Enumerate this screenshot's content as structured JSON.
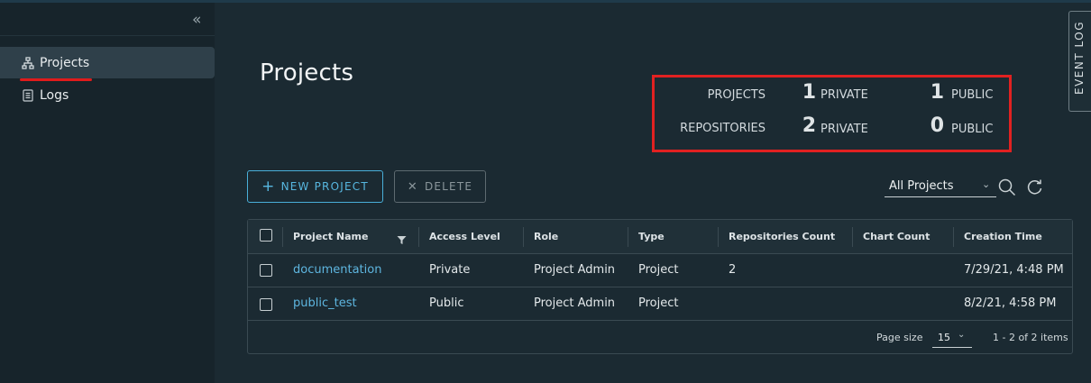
{
  "sidebar": {
    "collapse_glyph": "«",
    "items": [
      {
        "label": "Projects",
        "icon": "projects-tree-icon",
        "active": true
      },
      {
        "label": "Logs",
        "icon": "logs-document-icon",
        "active": false
      }
    ]
  },
  "page": {
    "title": "Projects"
  },
  "summary": {
    "projects_label": "PROJECTS",
    "projects_private": "1",
    "projects_public": "1",
    "repositories_label": "REPOSITORIES",
    "repositories_private": "2",
    "repositories_public": "0",
    "private_label": "PRIVATE",
    "public_label": "PUBLIC",
    "highlight_color": "#e12121"
  },
  "event_log": {
    "label": "EVENT LOG"
  },
  "toolbar": {
    "new_project_label": "NEW PROJECT",
    "delete_label": "DELETE",
    "filter_value": "All Projects",
    "search_icon": "search-icon",
    "refresh_icon": "refresh-icon"
  },
  "table": {
    "columns": [
      "Project Name",
      "Access Level",
      "Role",
      "Type",
      "Repositories Count",
      "Chart Count",
      "Creation Time"
    ],
    "rows": [
      {
        "name": "documentation",
        "access": "Private",
        "role": "Project Admin",
        "type": "Project",
        "repos": "2",
        "charts": "",
        "created": "7/29/21, 4:48 PM"
      },
      {
        "name": "public_test",
        "access": "Public",
        "role": "Project Admin",
        "type": "Project",
        "repos": "",
        "charts": "",
        "created": "8/2/21, 4:58 PM"
      }
    ],
    "footer": {
      "page_size_label": "Page size",
      "page_size_value": "15",
      "range_text": "1 - 2 of 2 items"
    }
  },
  "colors": {
    "accent": "#49afd9",
    "link": "#5eb6e0",
    "background": "#1b2a32",
    "sidebar": "#17242b"
  }
}
